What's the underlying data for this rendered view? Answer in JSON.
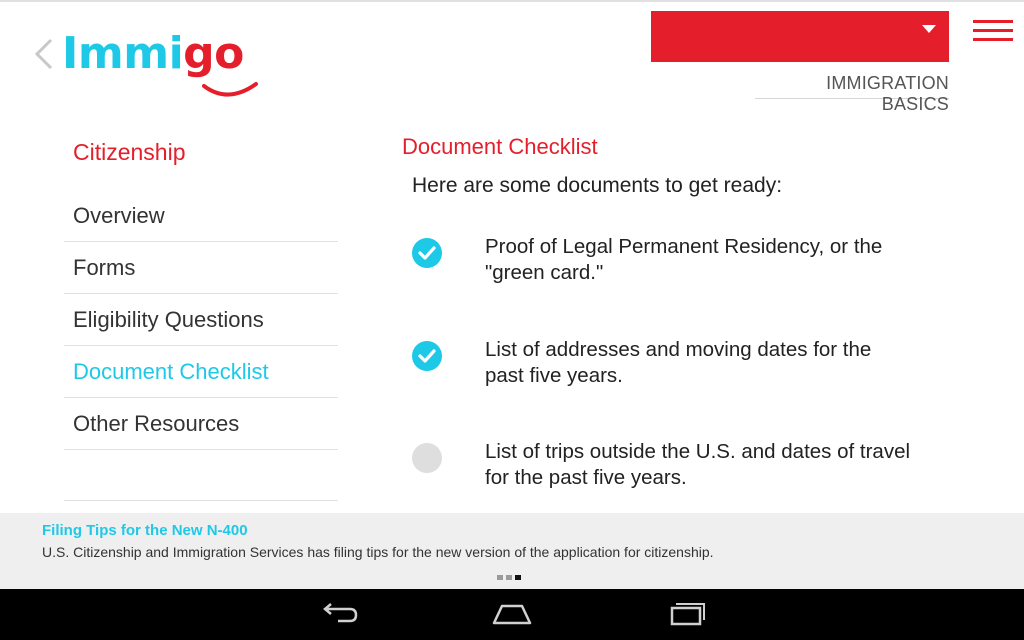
{
  "app": {
    "logo_text_main": "Immi",
    "logo_text_accent": "go",
    "section_dropdown_value": "",
    "section_label": "IMMIGRATION BASICS",
    "colors": {
      "brand_red": "#e41f2b",
      "brand_cyan": "#1ec9e8"
    }
  },
  "sidebar": {
    "title": "Citizenship",
    "items": [
      {
        "label": "Overview",
        "active": false
      },
      {
        "label": "Forms",
        "active": false
      },
      {
        "label": "Eligibility Questions",
        "active": false
      },
      {
        "label": "Document Checklist",
        "active": true
      },
      {
        "label": "Other Resources",
        "active": false
      }
    ]
  },
  "main": {
    "title": "Document Checklist",
    "intro": "Here are some documents to get ready:",
    "checklist": [
      {
        "text": "Proof of Legal Permanent Residency, or the \"green card.\"",
        "checked": true
      },
      {
        "text": "List of addresses and moving dates for the past five years.",
        "checked": true
      },
      {
        "text": "List of trips outside the U.S. and dates of travel for the past five years.",
        "checked": false
      }
    ]
  },
  "news": {
    "title": "Filing Tips for the New N-400",
    "body": "U.S. Citizenship and Immigration Services has filing tips for the new version of the application for citizenship.",
    "pager": {
      "count": 3,
      "active_index": 3
    }
  },
  "icons": {
    "back": "chevron-left-icon",
    "menu": "hamburger-menu-icon",
    "dropdown": "caret-down-icon",
    "check": "checkmark-icon",
    "nav_back": "android-back-icon",
    "nav_home": "android-home-icon",
    "nav_recents": "android-recents-icon"
  }
}
